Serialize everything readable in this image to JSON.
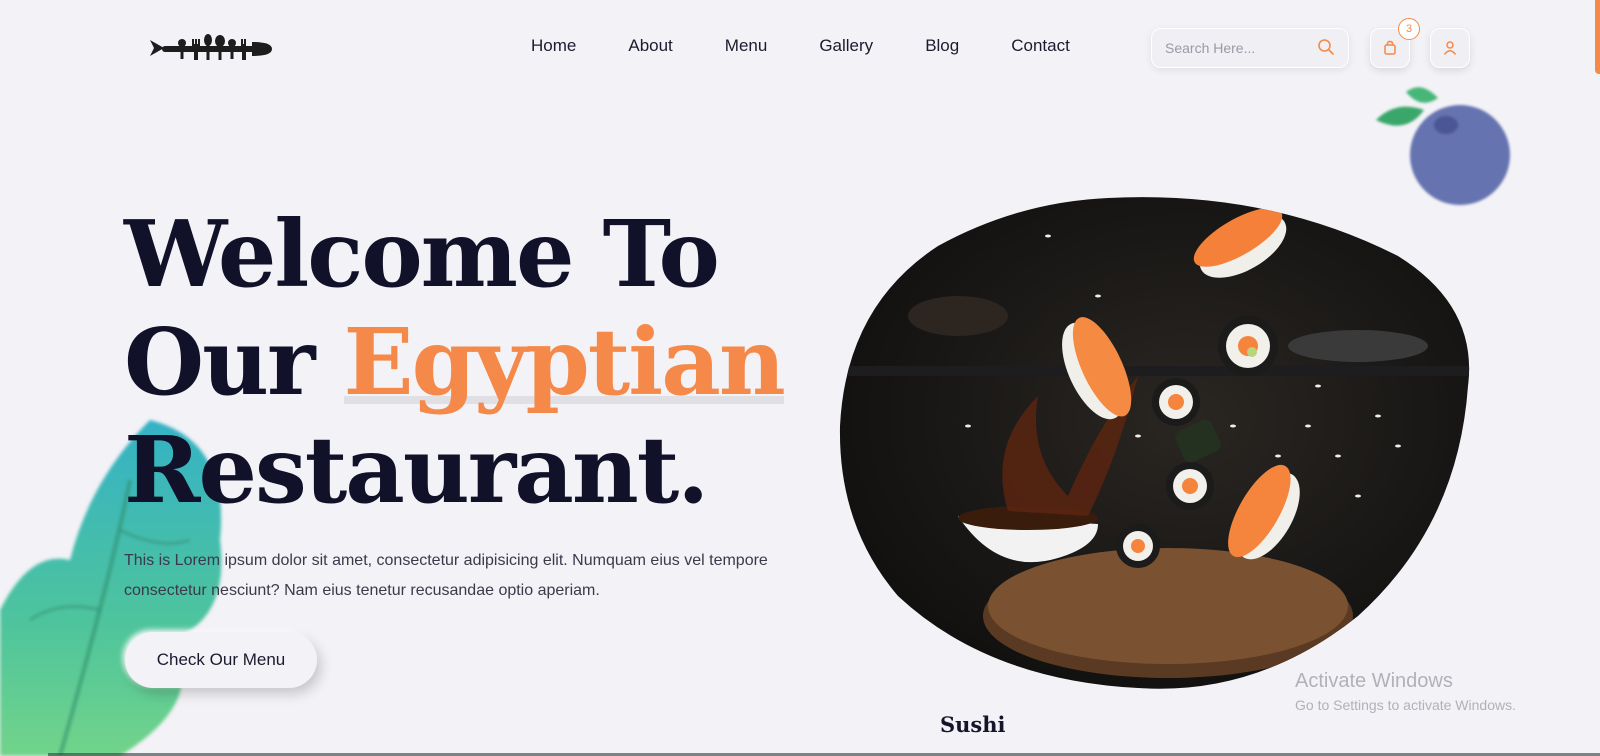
{
  "header": {
    "logo_alt": "restaurant logo",
    "nav": [
      "Home",
      "About",
      "Menu",
      "Gallery",
      "Blog",
      "Contact"
    ],
    "search": {
      "placeholder": "Search Here...",
      "value": ""
    },
    "cart_count": "3",
    "icons": {
      "search": "search-icon",
      "cart": "shopping-bag-icon",
      "user": "user-icon"
    }
  },
  "hero": {
    "title_line1": "Welcome To",
    "title_line2_plain": "Our ",
    "title_line2_accent": "Egyptian",
    "title_line3": "Restaurant.",
    "description": "This is Lorem ipsum dolor sit amet, consectetur adipisicing elit. Numquam eius vel tempore consectetur nesciunt? Nam eius tenetur recusandae optio aperiam.",
    "cta_label": "Check Our Menu"
  },
  "featured": {
    "label": "Sushi"
  },
  "watermark": {
    "line1": "Activate Windows",
    "line2": "Go to Settings to activate Windows."
  },
  "colors": {
    "accent": "#f5894a",
    "background": "#f3f2f6",
    "text_dark": "#11112a"
  }
}
